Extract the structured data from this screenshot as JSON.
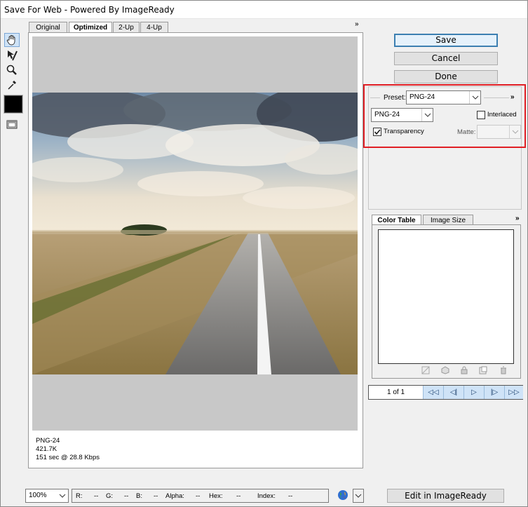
{
  "window": {
    "title": "Save For Web - Powered By ImageReady"
  },
  "tools": [
    {
      "name": "hand-tool",
      "icon": "hand-icon",
      "active": true
    },
    {
      "name": "slice-select-tool",
      "icon": "slice-select-icon"
    },
    {
      "name": "zoom-tool",
      "icon": "magnifier-icon"
    },
    {
      "name": "eyedropper-tool",
      "icon": "eyedropper-icon"
    }
  ],
  "tabs": [
    "Original",
    "Optimized",
    "2-Up",
    "4-Up"
  ],
  "selected_tab": "Optimized",
  "preview": {
    "format": "PNG-24",
    "size": "421.7K",
    "download_time": "151 sec @ 28.8 Kbps"
  },
  "buttons": {
    "save": "Save",
    "cancel": "Cancel",
    "done": "Done",
    "edit_imageready": "Edit in ImageReady"
  },
  "settings": {
    "preset_label": "Preset:",
    "preset_value": "PNG-24",
    "format_value": "PNG-24",
    "interlaced_label": "Interlaced",
    "interlaced_checked": false,
    "transparency_label": "Transparency",
    "transparency_checked": true,
    "matte_label": "Matte:",
    "matte_value": ""
  },
  "color_table": {
    "tabs": [
      "Color Table",
      "Image Size"
    ],
    "selected": "Color Table"
  },
  "animation": {
    "frame_counter": "1 of 1"
  },
  "status": {
    "zoom": "100%",
    "r_label": "R:",
    "r_value": "--",
    "g_label": "G:",
    "g_value": "--",
    "b_label": "B:",
    "b_value": "--",
    "alpha_label": "Alpha:",
    "alpha_value": "--",
    "hex_label": "Hex:",
    "hex_value": "--",
    "index_label": "Index:",
    "index_value": "--"
  },
  "colors": {
    "highlight": "#e01e24",
    "accent": "#3c7fb1",
    "canvas_bg": "#c8c8c8"
  }
}
